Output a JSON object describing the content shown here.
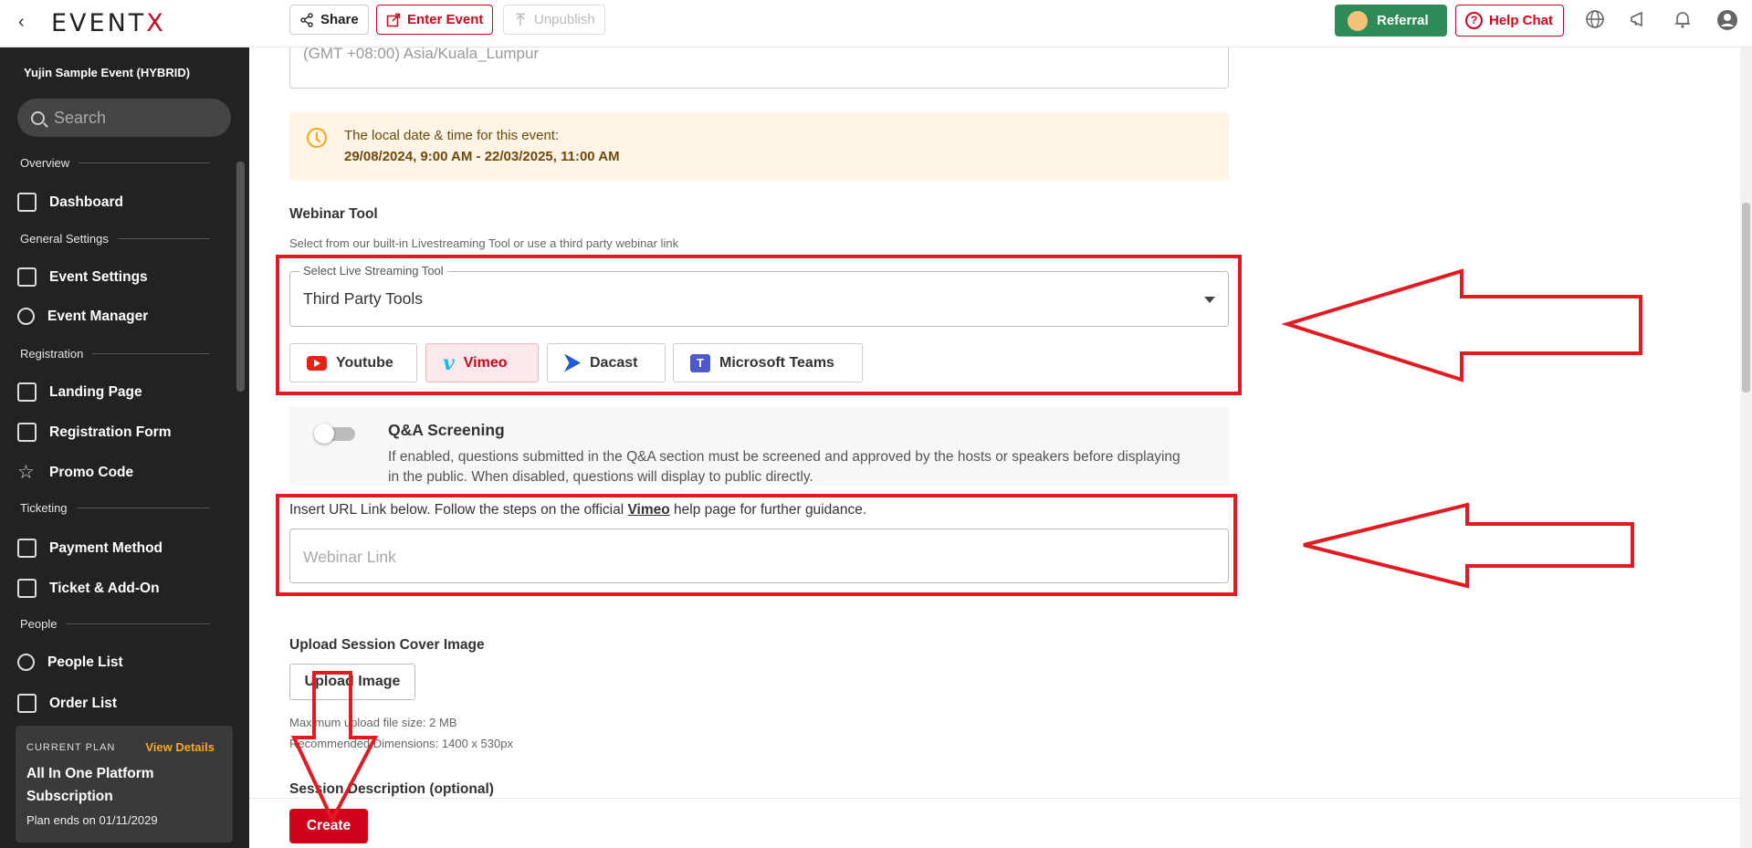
{
  "topbar": {
    "back_icon": "chevron-left-icon",
    "logo_prefix": "EVENT",
    "logo_suffix": "X",
    "share_label": "Share",
    "enter_event_label": "Enter Event",
    "unpublish_label": "Unpublish",
    "referral_label": "Referral",
    "help_chat_label": "Help Chat",
    "icons": [
      "globe-icon",
      "megaphone-icon",
      "bell-icon",
      "account-icon"
    ],
    "brand_color": "#d0021b",
    "referral_color": "#2e8b57"
  },
  "sidebar": {
    "event_name": "Yujin Sample Event (HYBRID)",
    "search_placeholder": "Search",
    "sections": {
      "overview": "Overview",
      "general": "General Settings",
      "registration": "Registration",
      "ticketing": "Ticketing",
      "people": "People"
    },
    "items": {
      "dashboard": "Dashboard",
      "event_settings": "Event Settings",
      "event_manager": "Event Manager",
      "landing_page": "Landing Page",
      "registration_form": "Registration Form",
      "promo_code": "Promo Code",
      "payment_method": "Payment Method",
      "ticket_addon": "Ticket & Add-On",
      "people_list": "People List",
      "order_list": "Order List"
    },
    "plan": {
      "label": "CURRENT PLAN",
      "view_details": "View Details",
      "name": "All In One Platform Subscription",
      "ends": "Plan ends on 01/11/2029"
    }
  },
  "main": {
    "timezone_value": "(GMT +08:00) Asia/Kuala_Lumpur",
    "notice_line1": "The local date & time for this event:",
    "notice_line2": "29/08/2024, 9:00 AM - 22/03/2025, 11:00 AM",
    "webinar_title": "Webinar Tool",
    "webinar_sub": "Select from our built-in Livestreaming Tool or use a third party webinar link",
    "select_legend": "Select Live Streaming Tool",
    "select_value": "Third Party Tools",
    "tools": [
      "Youtube",
      "Vimeo",
      "Dacast",
      "Microsoft Teams"
    ],
    "active_tool": "Vimeo",
    "qa_title": "Q&A Screening",
    "qa_desc": "If enabled, questions submitted in the Q&A section must be screened and approved by the hosts or speakers before displaying in the public. When disabled, questions will display to public directly.",
    "qa_enabled": false,
    "insert_prefix": "Insert URL Link below. Follow the steps on the official ",
    "insert_link": "Vimeo",
    "insert_suffix": " help page for further guidance.",
    "webinar_link_placeholder": "Webinar Link",
    "upload_title": "Upload Session Cover Image",
    "upload_button": "Upload Image",
    "upload_hint1": "Maximum upload file size: 2 MB",
    "upload_hint2": "Recommended Dimensions: 1400 x 530px",
    "description_title": "Session Description (optional)",
    "create_button": "Create"
  }
}
